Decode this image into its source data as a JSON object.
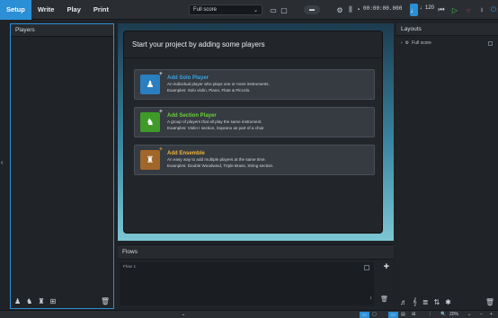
{
  "toolbar": {
    "modes": [
      "Setup",
      "Write",
      "Play",
      "Print"
    ],
    "active_mode": "Setup",
    "layout_select": "Full score",
    "timecode": "00:00:00.000",
    "tempo": "120"
  },
  "players_panel": {
    "title": "Players"
  },
  "dialog": {
    "title": "Start your project by adding some players",
    "cards": [
      {
        "title": "Add Solo Player",
        "desc1": "An individual player who plays one or more instruments.",
        "desc2": "Examples: Solo violin, Piano, Flute & Piccolo.",
        "color": "#3aa3e0",
        "icon_bg": "#2b7fc0"
      },
      {
        "title": "Add Section Player",
        "desc1": "A group of players that all play the same instrument.",
        "desc2": "Examples: Violin I section, Soprano as part of a choir",
        "color": "#6bd13a",
        "icon_bg": "#3f9a2a"
      },
      {
        "title": "Add Ensemble",
        "desc1": "An easy way to add multiple players at the same time.",
        "desc2": "Examples: Double Woodwind, Triple Brass, String section.",
        "color": "#f0b43a",
        "icon_bg": "#a0662a"
      }
    ]
  },
  "flows_panel": {
    "title": "Flows",
    "flow_name": "Flow 1",
    "flow_number": "1"
  },
  "layouts_panel": {
    "title": "Layouts",
    "item": "Full score"
  },
  "statusbar": {
    "zoom": "20%"
  }
}
